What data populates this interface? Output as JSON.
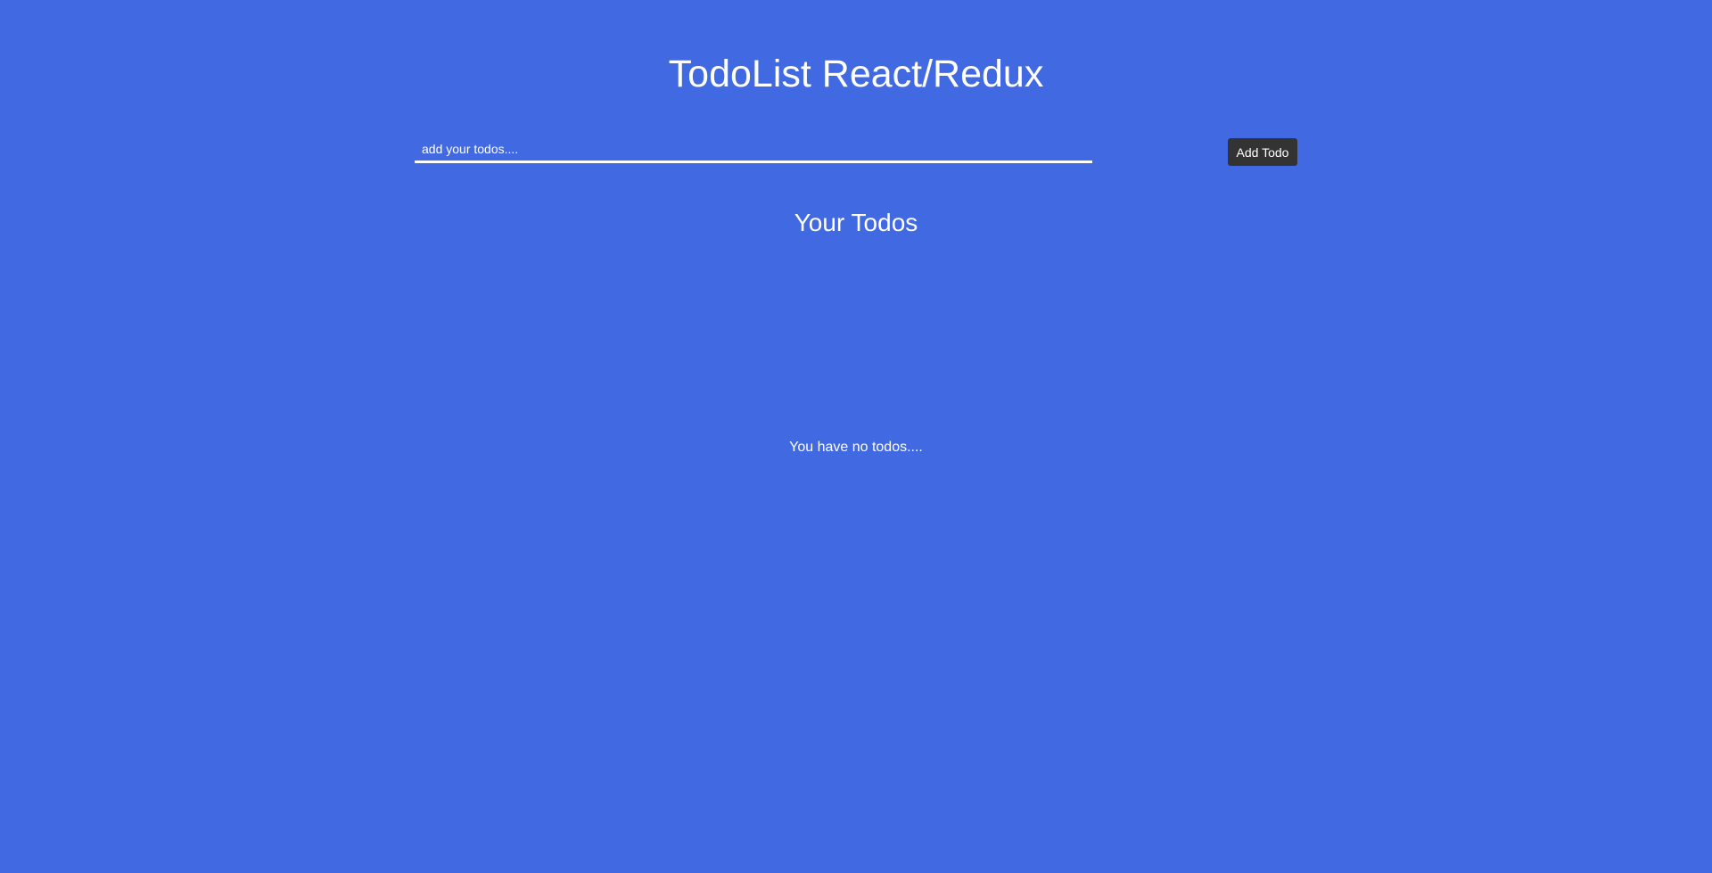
{
  "app": {
    "title": "TodoList React/Redux",
    "background_color": "#4169e1"
  },
  "form": {
    "input_placeholder": "add your todos....",
    "input_value": "",
    "add_button_label": "Add Todo",
    "button_color": "#333333"
  },
  "todos": {
    "heading": "Your Todos",
    "items": [],
    "empty_message": "You have no todos...."
  }
}
